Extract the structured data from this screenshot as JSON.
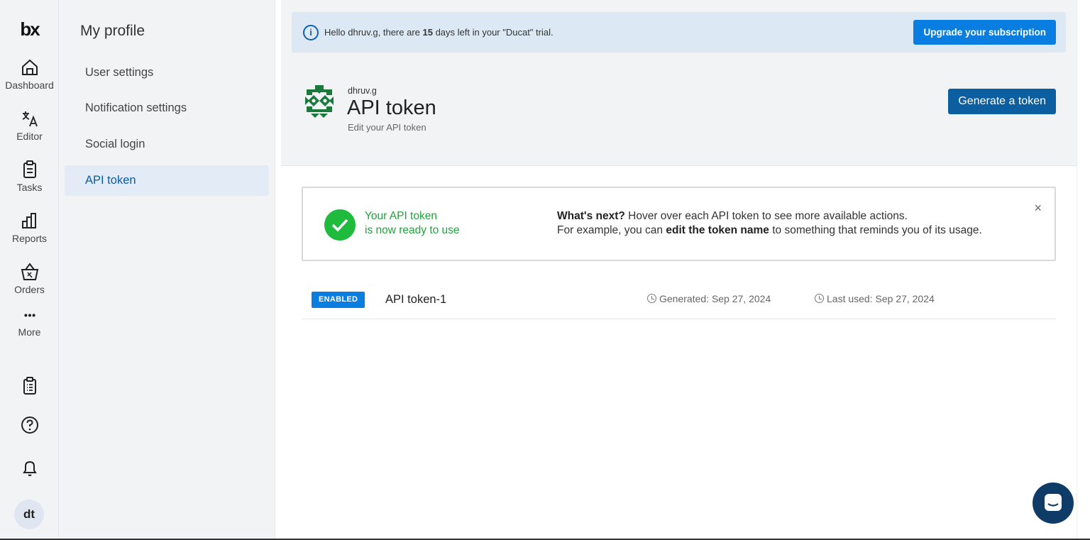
{
  "rail": {
    "logo": "bx",
    "items": [
      {
        "label": "Dashboard",
        "icon": "home-icon"
      },
      {
        "label": "Editor",
        "icon": "translate-icon"
      },
      {
        "label": "Tasks",
        "icon": "clipboard-icon"
      },
      {
        "label": "Reports",
        "icon": "bar-chart-icon"
      },
      {
        "label": "Orders",
        "icon": "basket-icon"
      },
      {
        "label": "More",
        "icon": "dots-icon"
      }
    ],
    "bottom_icons": [
      "checklist-icon",
      "help-icon",
      "bell-icon"
    ],
    "avatar_initials": "dt"
  },
  "sidebar": {
    "title": "My profile",
    "items": [
      {
        "label": "User settings"
      },
      {
        "label": "Notification settings"
      },
      {
        "label": "Social login"
      },
      {
        "label": "API token",
        "active": true
      }
    ]
  },
  "trial": {
    "prefix": "Hello dhruv.g, there are ",
    "days": "15",
    "suffix": " days left in your \"Ducat\" trial.",
    "upgrade_label": "Upgrade your subscription"
  },
  "header": {
    "username": "dhruv.g",
    "title": "API token",
    "subtitle": "Edit your API token",
    "generate_label": "Generate a token"
  },
  "ready": {
    "line1": "Your API token",
    "line2": "is now ready to use",
    "next_bold": "What's next?",
    "next_rest": " Hover over each API token to see more available actions.",
    "example_prefix": "For example, you can ",
    "example_bold": "edit the token name",
    "example_suffix": " to something that reminds you of its usage.",
    "close": "×"
  },
  "tokens": [
    {
      "status": "ENABLED",
      "name": "API token-1",
      "generated": "Generated: Sep 27, 2024",
      "last_used": "Last used: Sep 27, 2024"
    }
  ],
  "colors": {
    "accent": "#0a7ee0",
    "primary_dark": "#0b5fa0",
    "success": "#1fbb3c",
    "chat": "#0f3b67"
  }
}
